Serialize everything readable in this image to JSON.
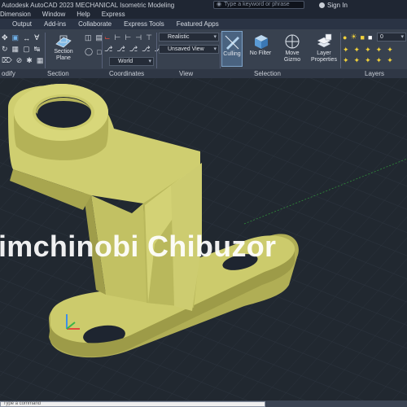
{
  "window": {
    "title": "Autodesk AutoCAD 2023   MECHANICAL Isometric Modeling",
    "search_placeholder": "Type a keyword or phrase",
    "signin": "Sign In"
  },
  "menubar": {
    "items": [
      "Dimension",
      "Window",
      "Help",
      "Express"
    ]
  },
  "tabs": {
    "items": [
      "",
      "Output",
      "Add-ins",
      "Collaborate",
      "Express Tools",
      "Featured Apps"
    ]
  },
  "ribbon": {
    "section_plane": "Section Plane",
    "visual_style": "Realistic",
    "saved_view": "Unsaved View",
    "coordinates": "World",
    "culling": "Culling",
    "no_filter": "No Filter",
    "move_gizmo": "Move Gizmo",
    "layer_properties": "Layer Properties",
    "layer_value": "0",
    "panels": {
      "modify": "odify",
      "section": "Section",
      "coordinates": "Coordinates",
      "view": "View",
      "selection": "Selection",
      "layers": "Layers"
    }
  },
  "viewport": {
    "watermark": "imchinobi Chibuzor"
  },
  "command": {
    "placeholder": "Type a command"
  },
  "colors": {
    "model": "#c9c866",
    "model_dark": "#a8a64e",
    "background": "#212830",
    "grid": "#2b333d"
  }
}
